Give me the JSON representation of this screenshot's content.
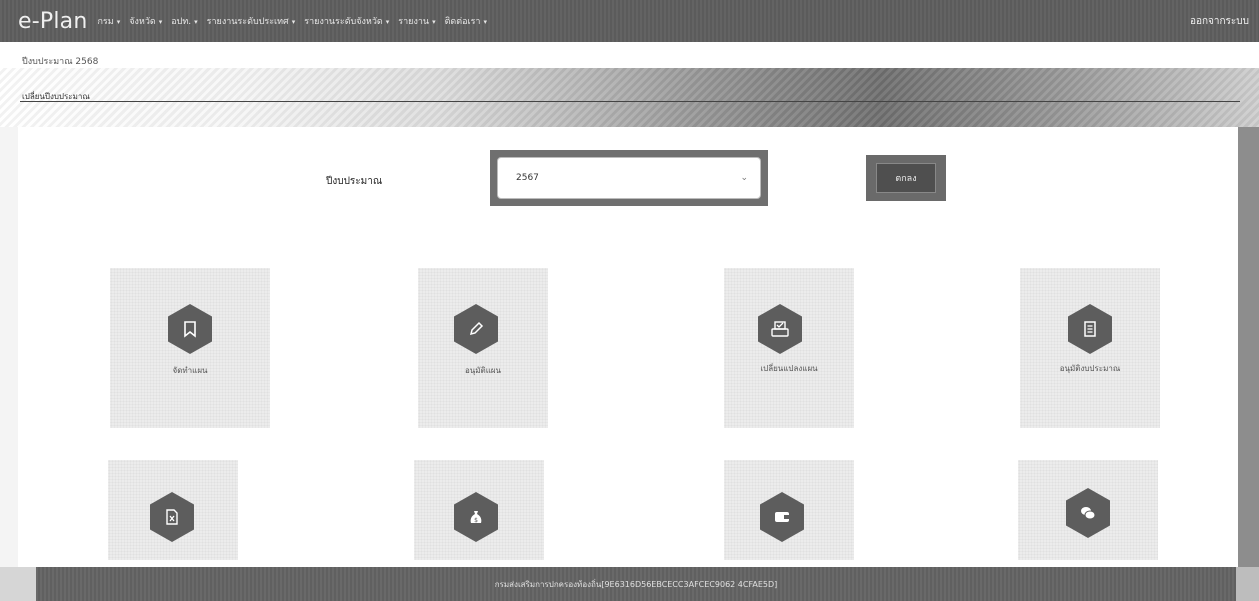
{
  "nav": {
    "brand": "e-Plan",
    "menu": [
      {
        "label": "กรม"
      },
      {
        "label": "จังหวัด"
      },
      {
        "label": "อปท."
      },
      {
        "label": "รายงานระดับประเทศ"
      },
      {
        "label": "รายงานระดับจังหวัด"
      },
      {
        "label": "รายงาน"
      },
      {
        "label": "ติดต่อเรา"
      }
    ],
    "caret": "▾",
    "logout": "ออกจากระบบ"
  },
  "header": {
    "fiscal_year_label": "ปีงบประมาณ 2568",
    "change_link": "เปลี่ยนปีงบประมาณ"
  },
  "form": {
    "label": "ปีงบประมาณ",
    "select_value": "2567",
    "ok_label": "ตกลง"
  },
  "tiles": [
    {
      "label": "จัดทำแผน",
      "icon": "bookmark-icon"
    },
    {
      "label": "อนุมัติแผน",
      "icon": "pencil-icon"
    },
    {
      "label": "เปลี่ยนแปลงแผน",
      "icon": "printer-check-icon"
    },
    {
      "label": "อนุมัติงบประมาณ",
      "icon": "document-icon"
    },
    {
      "label": "",
      "icon": "excel-file-icon"
    },
    {
      "label": "",
      "icon": "money-bag-icon"
    },
    {
      "label": "",
      "icon": "wallet-icon"
    },
    {
      "label": "",
      "icon": "coins-icon"
    }
  ],
  "footer": {
    "text": "กรมส่งเสริมการปกครองท้องถิ่น[9E6316D56EBCECC3AFCEC9062 4CFAE5D]"
  },
  "colors": {
    "nav_bg": "#5e5e5e",
    "hex_icon_bg": "#5d5d5d",
    "footer_bg": "#646464"
  }
}
